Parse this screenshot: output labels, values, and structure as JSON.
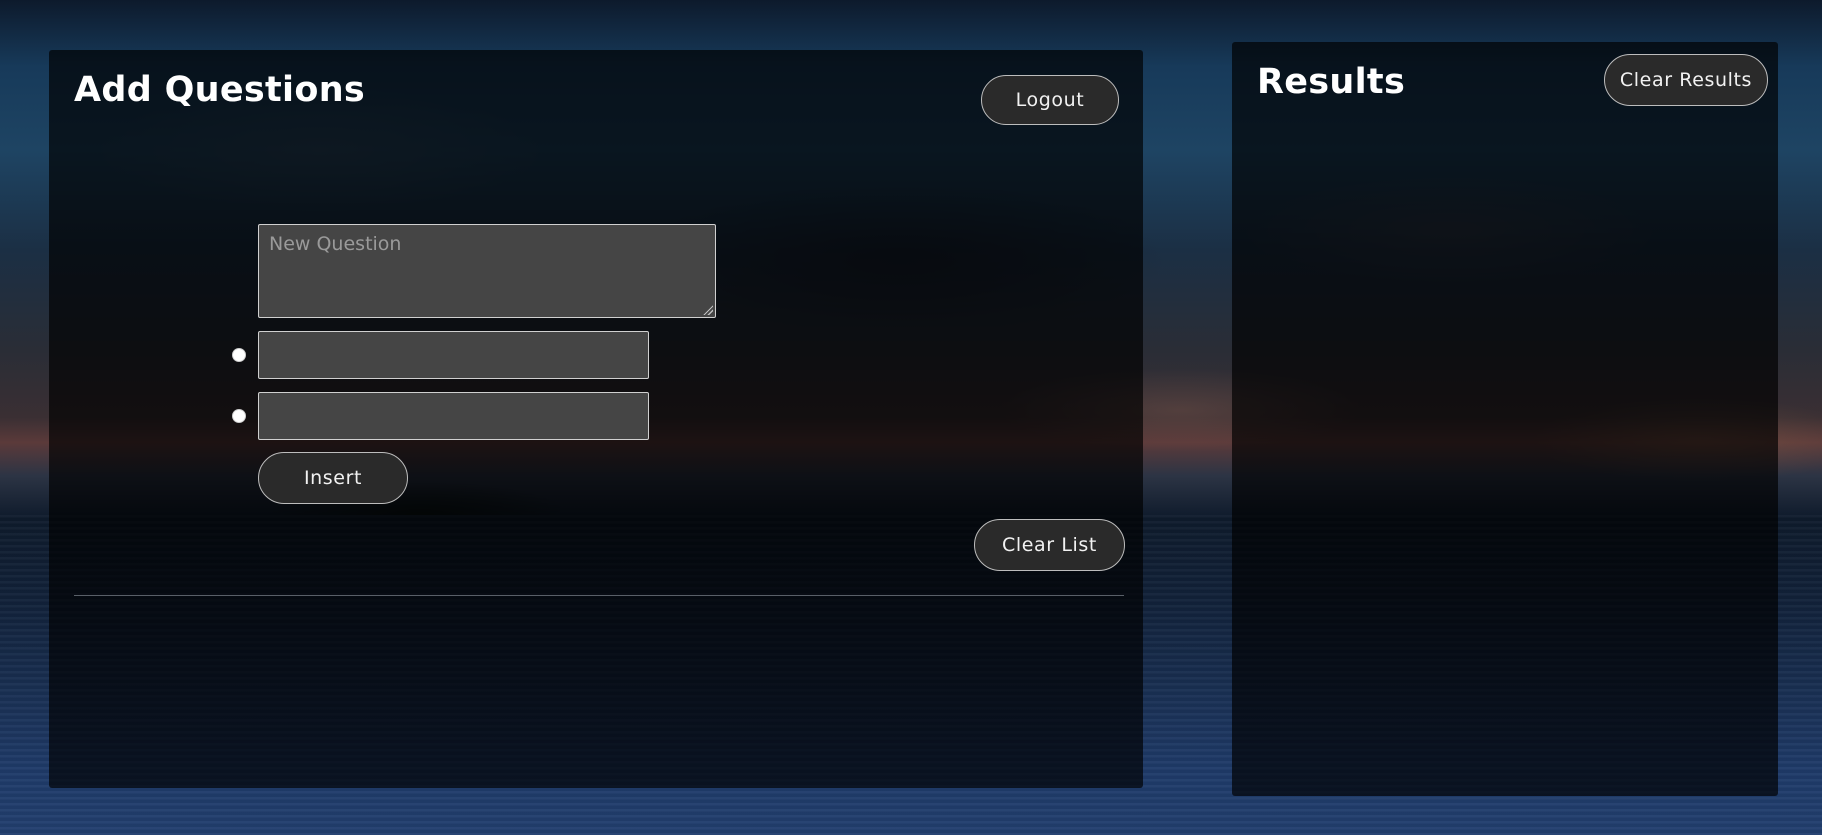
{
  "add_panel": {
    "title": "Add Questions",
    "logout_label": "Logout",
    "question_placeholder": "New Question",
    "answers": [
      {
        "value": ""
      },
      {
        "value": ""
      }
    ],
    "insert_label": "Insert",
    "clear_list_label": "Clear List"
  },
  "results_panel": {
    "title": "Results",
    "clear_results_label": "Clear Results"
  },
  "colors": {
    "panel_overlay": "#000000",
    "button_bg": "#2a2a2a",
    "input_bg": "#454545",
    "text": "#ffffff"
  }
}
